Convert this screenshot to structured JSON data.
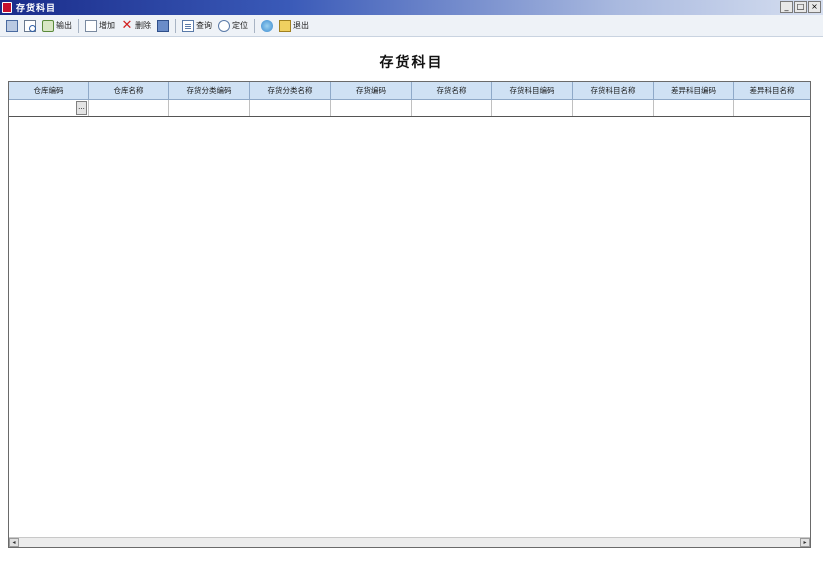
{
  "window": {
    "title": "存货科目",
    "buttons": {
      "minimize": "_",
      "maximize": "□",
      "close": "×"
    }
  },
  "toolbar": {
    "items": [
      {
        "name": "print",
        "label": "",
        "icon": "print-icon"
      },
      {
        "name": "preview",
        "label": "",
        "icon": "preview-icon"
      },
      {
        "name": "output",
        "label": "输出",
        "icon": "output-icon"
      },
      {
        "name": "add",
        "label": "增加",
        "icon": "new-document-icon"
      },
      {
        "name": "delete",
        "label": "删除",
        "icon": "delete-icon"
      },
      {
        "name": "save",
        "label": "",
        "icon": "save-icon"
      },
      {
        "name": "query",
        "label": "查询",
        "icon": "query-icon"
      },
      {
        "name": "locate",
        "label": "定位",
        "icon": "locate-icon"
      },
      {
        "name": "help",
        "label": "",
        "icon": "help-icon"
      },
      {
        "name": "exit",
        "label": "退出",
        "icon": "exit-icon"
      }
    ]
  },
  "page": {
    "title": "存货科目"
  },
  "grid": {
    "columns": [
      "仓库编码",
      "仓库名称",
      "存货分类编码",
      "存货分类名称",
      "存货编码",
      "存货名称",
      "存货科目编码",
      "存货科目名称",
      "差异科目编码",
      "差异科目名称"
    ],
    "row": {
      "lookup_button": "..."
    }
  },
  "scrollbar": {
    "left_arrow": "◂",
    "right_arrow": "▸"
  }
}
